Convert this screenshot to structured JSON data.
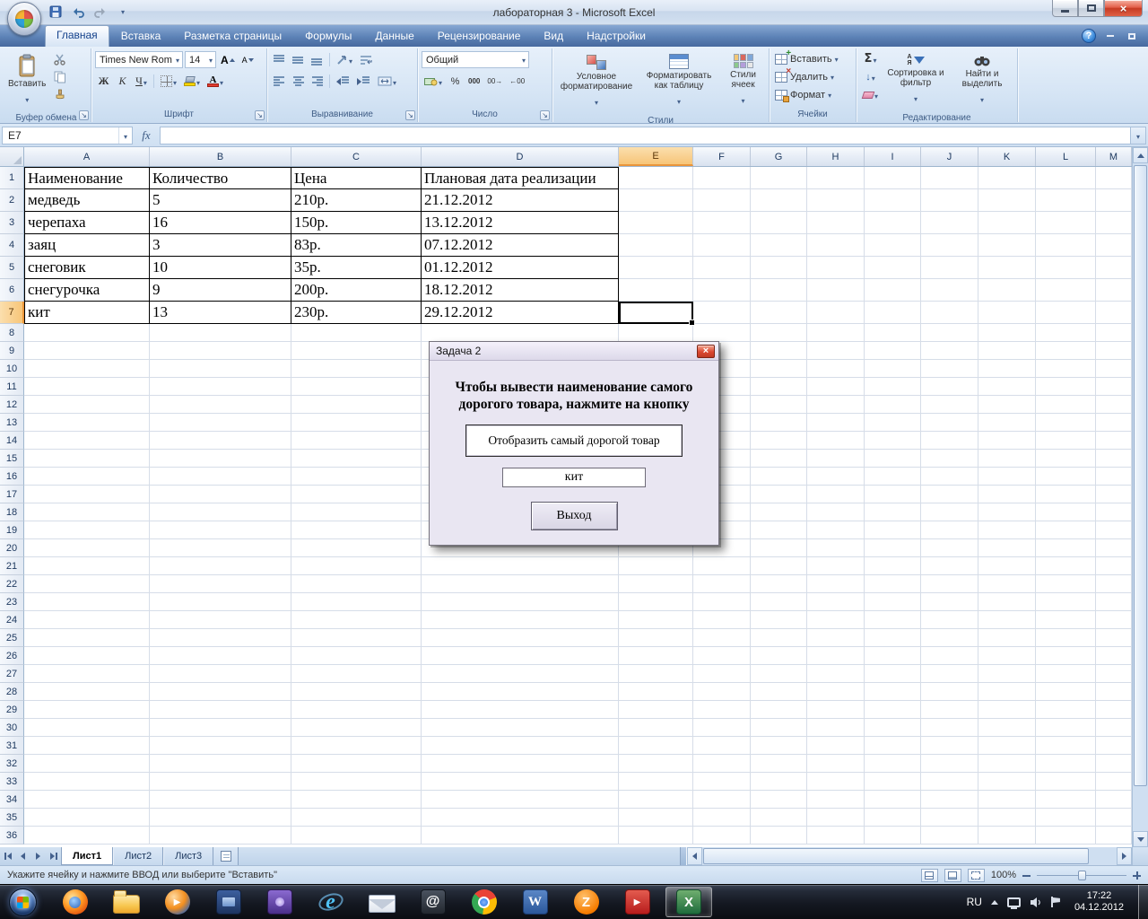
{
  "window": {
    "title": "лабораторная 3  -  Microsoft Excel"
  },
  "icons": {
    "sigma": "Σ",
    "help": "?",
    "close": "×",
    "increase_decimal": "00→",
    "decrease_decimal": "←00"
  },
  "ribbon": {
    "tabs": [
      "Главная",
      "Вставка",
      "Разметка страницы",
      "Формулы",
      "Данные",
      "Рецензирование",
      "Вид",
      "Надстройки"
    ],
    "active_tab": "Главная",
    "clipboard": {
      "label": "Буфер обмена",
      "paste": "Вставить"
    },
    "font": {
      "label": "Шрифт",
      "name": "Times New Rom",
      "size": "14",
      "bold": "Ж",
      "italic": "К",
      "underline": "Ч"
    },
    "alignment": {
      "label": "Выравнивание"
    },
    "number": {
      "label": "Число",
      "format": "Общий",
      "percent": "%",
      "thousands": "000"
    },
    "styles": {
      "label": "Стили",
      "conditional": "Условное форматирование",
      "as_table": "Форматировать как таблицу",
      "cell_styles": "Стили ячеек"
    },
    "cells": {
      "label": "Ячейки",
      "insert": "Вставить",
      "delete": "Удалить",
      "format": "Формат"
    },
    "editing": {
      "label": "Редактирование",
      "sort": "Сортировка и фильтр",
      "find": "Найти и выделить",
      "sort_letters_top": "А",
      "sort_letters_bottom": "Я"
    }
  },
  "formula_bar": {
    "name_box": "E7",
    "fx": "fx",
    "formula": ""
  },
  "grid": {
    "columns": [
      "A",
      "B",
      "C",
      "D",
      "E",
      "F",
      "G",
      "H",
      "I",
      "J",
      "K",
      "L",
      "M"
    ],
    "row_count": 36,
    "selected_col": "E",
    "selected_row": 7,
    "cells": [
      [
        "Наименование",
        "Количество",
        "Цена",
        "Плановая дата реализации"
      ],
      [
        "медведь",
        "5",
        "210р.",
        "21.12.2012"
      ],
      [
        "черепаха",
        "16",
        "150р.",
        "13.12.2012"
      ],
      [
        "заяц",
        "3",
        "83р.",
        "07.12.2012"
      ],
      [
        "снеговик",
        "10",
        "35р.",
        "01.12.2012"
      ],
      [
        "снегурочка",
        "9",
        "200р.",
        "18.12.2012"
      ],
      [
        "кит",
        "13",
        "230р.",
        "29.12.2012"
      ]
    ]
  },
  "dialog": {
    "title": "Задача 2",
    "message_lines": [
      "Чтобы вывести наименование самого",
      "дорогого товара, нажмите на кнопку"
    ],
    "show_button": "Отобразить самый дорогой товар",
    "result_value": "кит",
    "exit_button": "Выход"
  },
  "sheets": {
    "tabs": [
      "Лист1",
      "Лист2",
      "Лист3"
    ],
    "active": "Лист1"
  },
  "status_bar": {
    "message": "Укажите ячейку и нажмите ВВОД или выберите \"Вставить\"",
    "zoom": "100%"
  },
  "taskbar": {
    "apps": [
      "firefox",
      "explorer",
      "media-player",
      "app-blue",
      "app-purple",
      "internet-explorer",
      "mail",
      "email-at",
      "chrome",
      "word",
      "zona",
      "media-red",
      "excel"
    ],
    "active_app": "excel",
    "app_glyphs": {
      "media-player": "▶",
      "internet-explorer": "e",
      "email-at": "@",
      "word": "W",
      "zona": "Z",
      "media-red": "▶",
      "excel": "X"
    },
    "tray": {
      "language": "RU",
      "time": "17:22",
      "date": "04.12.2012"
    }
  }
}
